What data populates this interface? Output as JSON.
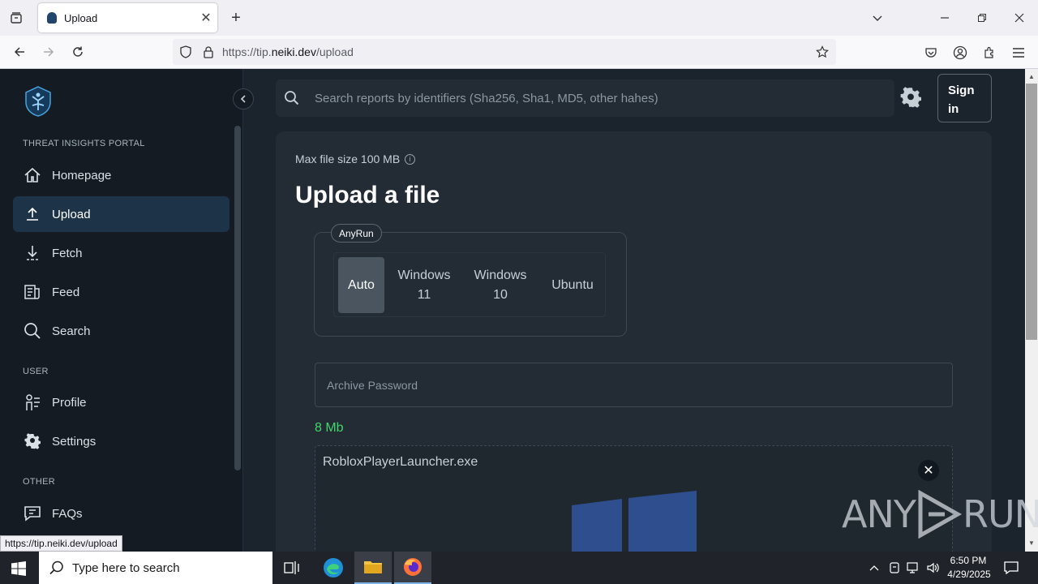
{
  "browser": {
    "tab_title": "Upload",
    "url_prefix": "https://tip.",
    "url_domain": "neiki.dev",
    "url_path": "/upload",
    "status_url": "https://tip.neiki.dev/upload"
  },
  "sidebar": {
    "section_portal": "THREAT INSIGHTS PORTAL",
    "section_user": "USER",
    "section_other": "OTHER",
    "items": [
      {
        "label": "Homepage",
        "icon": "home-icon"
      },
      {
        "label": "Upload",
        "icon": "upload-icon",
        "active": true
      },
      {
        "label": "Fetch",
        "icon": "fetch-icon"
      },
      {
        "label": "Feed",
        "icon": "feed-icon"
      },
      {
        "label": "Search",
        "icon": "search-icon"
      },
      {
        "label": "Profile",
        "icon": "profile-icon"
      },
      {
        "label": "Settings",
        "icon": "gear-icon"
      },
      {
        "label": "FAQs",
        "icon": "faq-icon"
      }
    ]
  },
  "header": {
    "search_placeholder": "Search reports by identifiers (Sha256, Sha1, MD5, other hahes)",
    "signin_line1": "Sign",
    "signin_line2": "in"
  },
  "main": {
    "max_size": "Max file size 100 MB",
    "title": "Upload a file",
    "anyrun_label": "AnyRun",
    "os_options": [
      {
        "line1": "Auto",
        "line2": "",
        "selected": true
      },
      {
        "line1": "Windows",
        "line2": "11"
      },
      {
        "line1": "Windows",
        "line2": "10"
      },
      {
        "line1": "Ubuntu",
        "line2": ""
      }
    ],
    "password_placeholder": "Archive Password",
    "file_size": "8 Mb",
    "file_name": "RobloxPlayerLauncher.exe"
  },
  "watermark": {
    "left": "ANY",
    "right": "RUN"
  },
  "taskbar": {
    "search_placeholder": "Type here to search",
    "time": "6:50 PM",
    "date": "4/29/2025"
  },
  "colors": {
    "accent": "#1d3448",
    "size_green": "#3fd86b",
    "windows_blue": "#2e4e8e"
  }
}
